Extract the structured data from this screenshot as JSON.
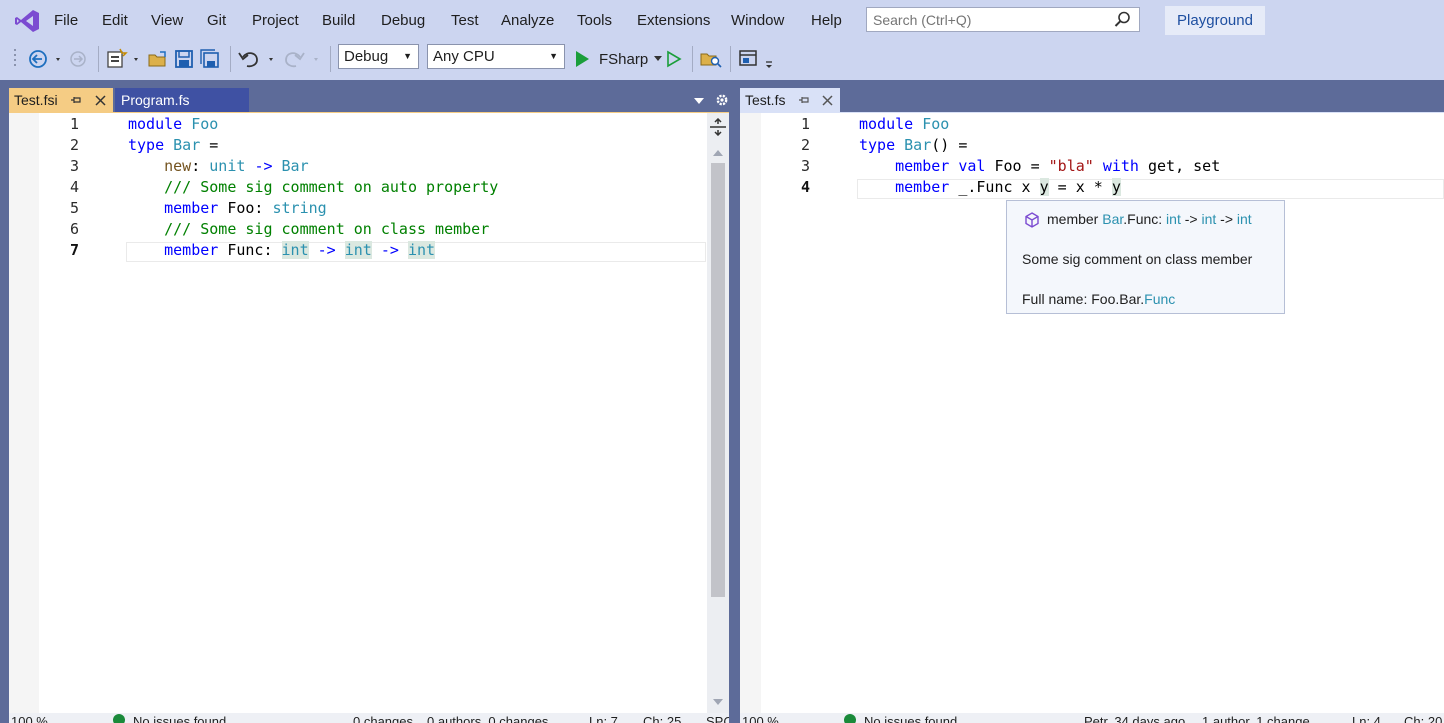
{
  "menu": [
    "File",
    "Edit",
    "View",
    "Git",
    "Project",
    "Build",
    "Debug",
    "Test",
    "Analyze",
    "Tools",
    "Extensions",
    "Window",
    "Help"
  ],
  "search": {
    "placeholder": "Search (Ctrl+Q)"
  },
  "playground_label": "Playground",
  "toolbar": {
    "config": "Debug",
    "platform": "Any CPU",
    "start_project": "FSharp"
  },
  "left_pane": {
    "tabs": [
      {
        "label": "Test.fsi",
        "active": true
      },
      {
        "label": "Program.fs",
        "active": false
      }
    ],
    "lines": [
      {
        "n": "1",
        "indent": "",
        "tokens": [
          {
            "t": "module",
            "c": "kw"
          },
          {
            "t": " "
          },
          {
            "t": "Foo",
            "c": "ty"
          }
        ]
      },
      {
        "n": "2",
        "indent": "",
        "tokens": [
          {
            "t": "type",
            "c": "kw"
          },
          {
            "t": " "
          },
          {
            "t": "Bar",
            "c": "ty"
          },
          {
            "t": " ="
          }
        ]
      },
      {
        "n": "3",
        "indent": "    ",
        "tokens": [
          {
            "t": "new",
            "c": "fn"
          },
          {
            "t": ": "
          },
          {
            "t": "unit",
            "c": "ty"
          },
          {
            "t": " "
          },
          {
            "t": "->",
            "c": "kw"
          },
          {
            "t": " "
          },
          {
            "t": "Bar",
            "c": "ty"
          }
        ]
      },
      {
        "n": "4",
        "indent": "    ",
        "tokens": [
          {
            "t": "/// Some sig comment on auto property",
            "c": "cm"
          }
        ]
      },
      {
        "n": "5",
        "indent": "    ",
        "tokens": [
          {
            "t": "member",
            "c": "kw"
          },
          {
            "t": " Foo: "
          },
          {
            "t": "string",
            "c": "ty"
          }
        ]
      },
      {
        "n": "6",
        "indent": "    ",
        "tokens": [
          {
            "t": "/// Some sig comment on class member",
            "c": "cm"
          }
        ]
      },
      {
        "n": "7",
        "indent": "    ",
        "tokens": [
          {
            "t": "member",
            "c": "kw"
          },
          {
            "t": " Func: "
          },
          {
            "t": "int",
            "c": "ty hl"
          },
          {
            "t": " "
          },
          {
            "t": "->",
            "c": "kw"
          },
          {
            "t": " "
          },
          {
            "t": "int",
            "c": "ty hl"
          },
          {
            "t": " "
          },
          {
            "t": "->",
            "c": "kw"
          },
          {
            "t": " "
          },
          {
            "t": "int",
            "c": "ty hl"
          }
        ]
      }
    ],
    "active_line": "7",
    "status": {
      "zoom": "100 %",
      "issues": "No issues found",
      "changes": "0 changes",
      "authors": "0 authors, 0 changes",
      "ln": "Ln: 7",
      "ch": "Ch: 25",
      "enc": "SPC"
    }
  },
  "right_pane": {
    "tabs": [
      {
        "label": "Test.fs",
        "active": true
      }
    ],
    "lines": [
      {
        "n": "1",
        "indent": "",
        "tokens": [
          {
            "t": "module",
            "c": "kw"
          },
          {
            "t": " "
          },
          {
            "t": "Foo",
            "c": "ty"
          }
        ]
      },
      {
        "n": "2",
        "indent": "",
        "tokens": [
          {
            "t": "type",
            "c": "kw"
          },
          {
            "t": " "
          },
          {
            "t": "Bar",
            "c": "ty"
          },
          {
            "t": "() ="
          }
        ]
      },
      {
        "n": "3",
        "indent": "    ",
        "tokens": [
          {
            "t": "member",
            "c": "kw"
          },
          {
            "t": " "
          },
          {
            "t": "val",
            "c": "kw"
          },
          {
            "t": " Foo = "
          },
          {
            "t": "\"bla\"",
            "c": "st"
          },
          {
            "t": " "
          },
          {
            "t": "with",
            "c": "kw"
          },
          {
            "t": " get, set"
          }
        ]
      },
      {
        "n": "4",
        "indent": "    ",
        "tokens": [
          {
            "t": "member",
            "c": "kw"
          },
          {
            "t": " _.Func x "
          },
          {
            "t": "y",
            "c": "hl"
          },
          {
            "t": " = x * "
          },
          {
            "t": "y",
            "c": "hl"
          }
        ]
      }
    ],
    "active_line": "4",
    "tooltip": {
      "signature": [
        {
          "t": "member "
        },
        {
          "t": "Bar",
          "c": "tt-ty"
        },
        {
          "t": ".Func: "
        },
        {
          "t": "int",
          "c": "tt-ty"
        },
        {
          "t": " -> "
        },
        {
          "t": "int",
          "c": "tt-ty"
        },
        {
          "t": " -> "
        },
        {
          "t": "int",
          "c": "tt-ty"
        }
      ],
      "doc": "Some sig comment on class member",
      "fullname_prefix": "Full name: Foo.Bar.",
      "fullname_member": "Func"
    },
    "status": {
      "zoom": "100 %",
      "issues": "No issues found",
      "blame": "Petr, 34 days ago",
      "authors": "1 author, 1 change",
      "ln": "Ln: 4",
      "ch": "Ch: 20"
    }
  },
  "colors": {
    "chrome": "#ccd5f0",
    "frame": "#5d6b99",
    "active_tab": "#f5cc84",
    "keyword": "#0000ff",
    "type": "#2b91af",
    "comment": "#008000",
    "string": "#a31515"
  }
}
